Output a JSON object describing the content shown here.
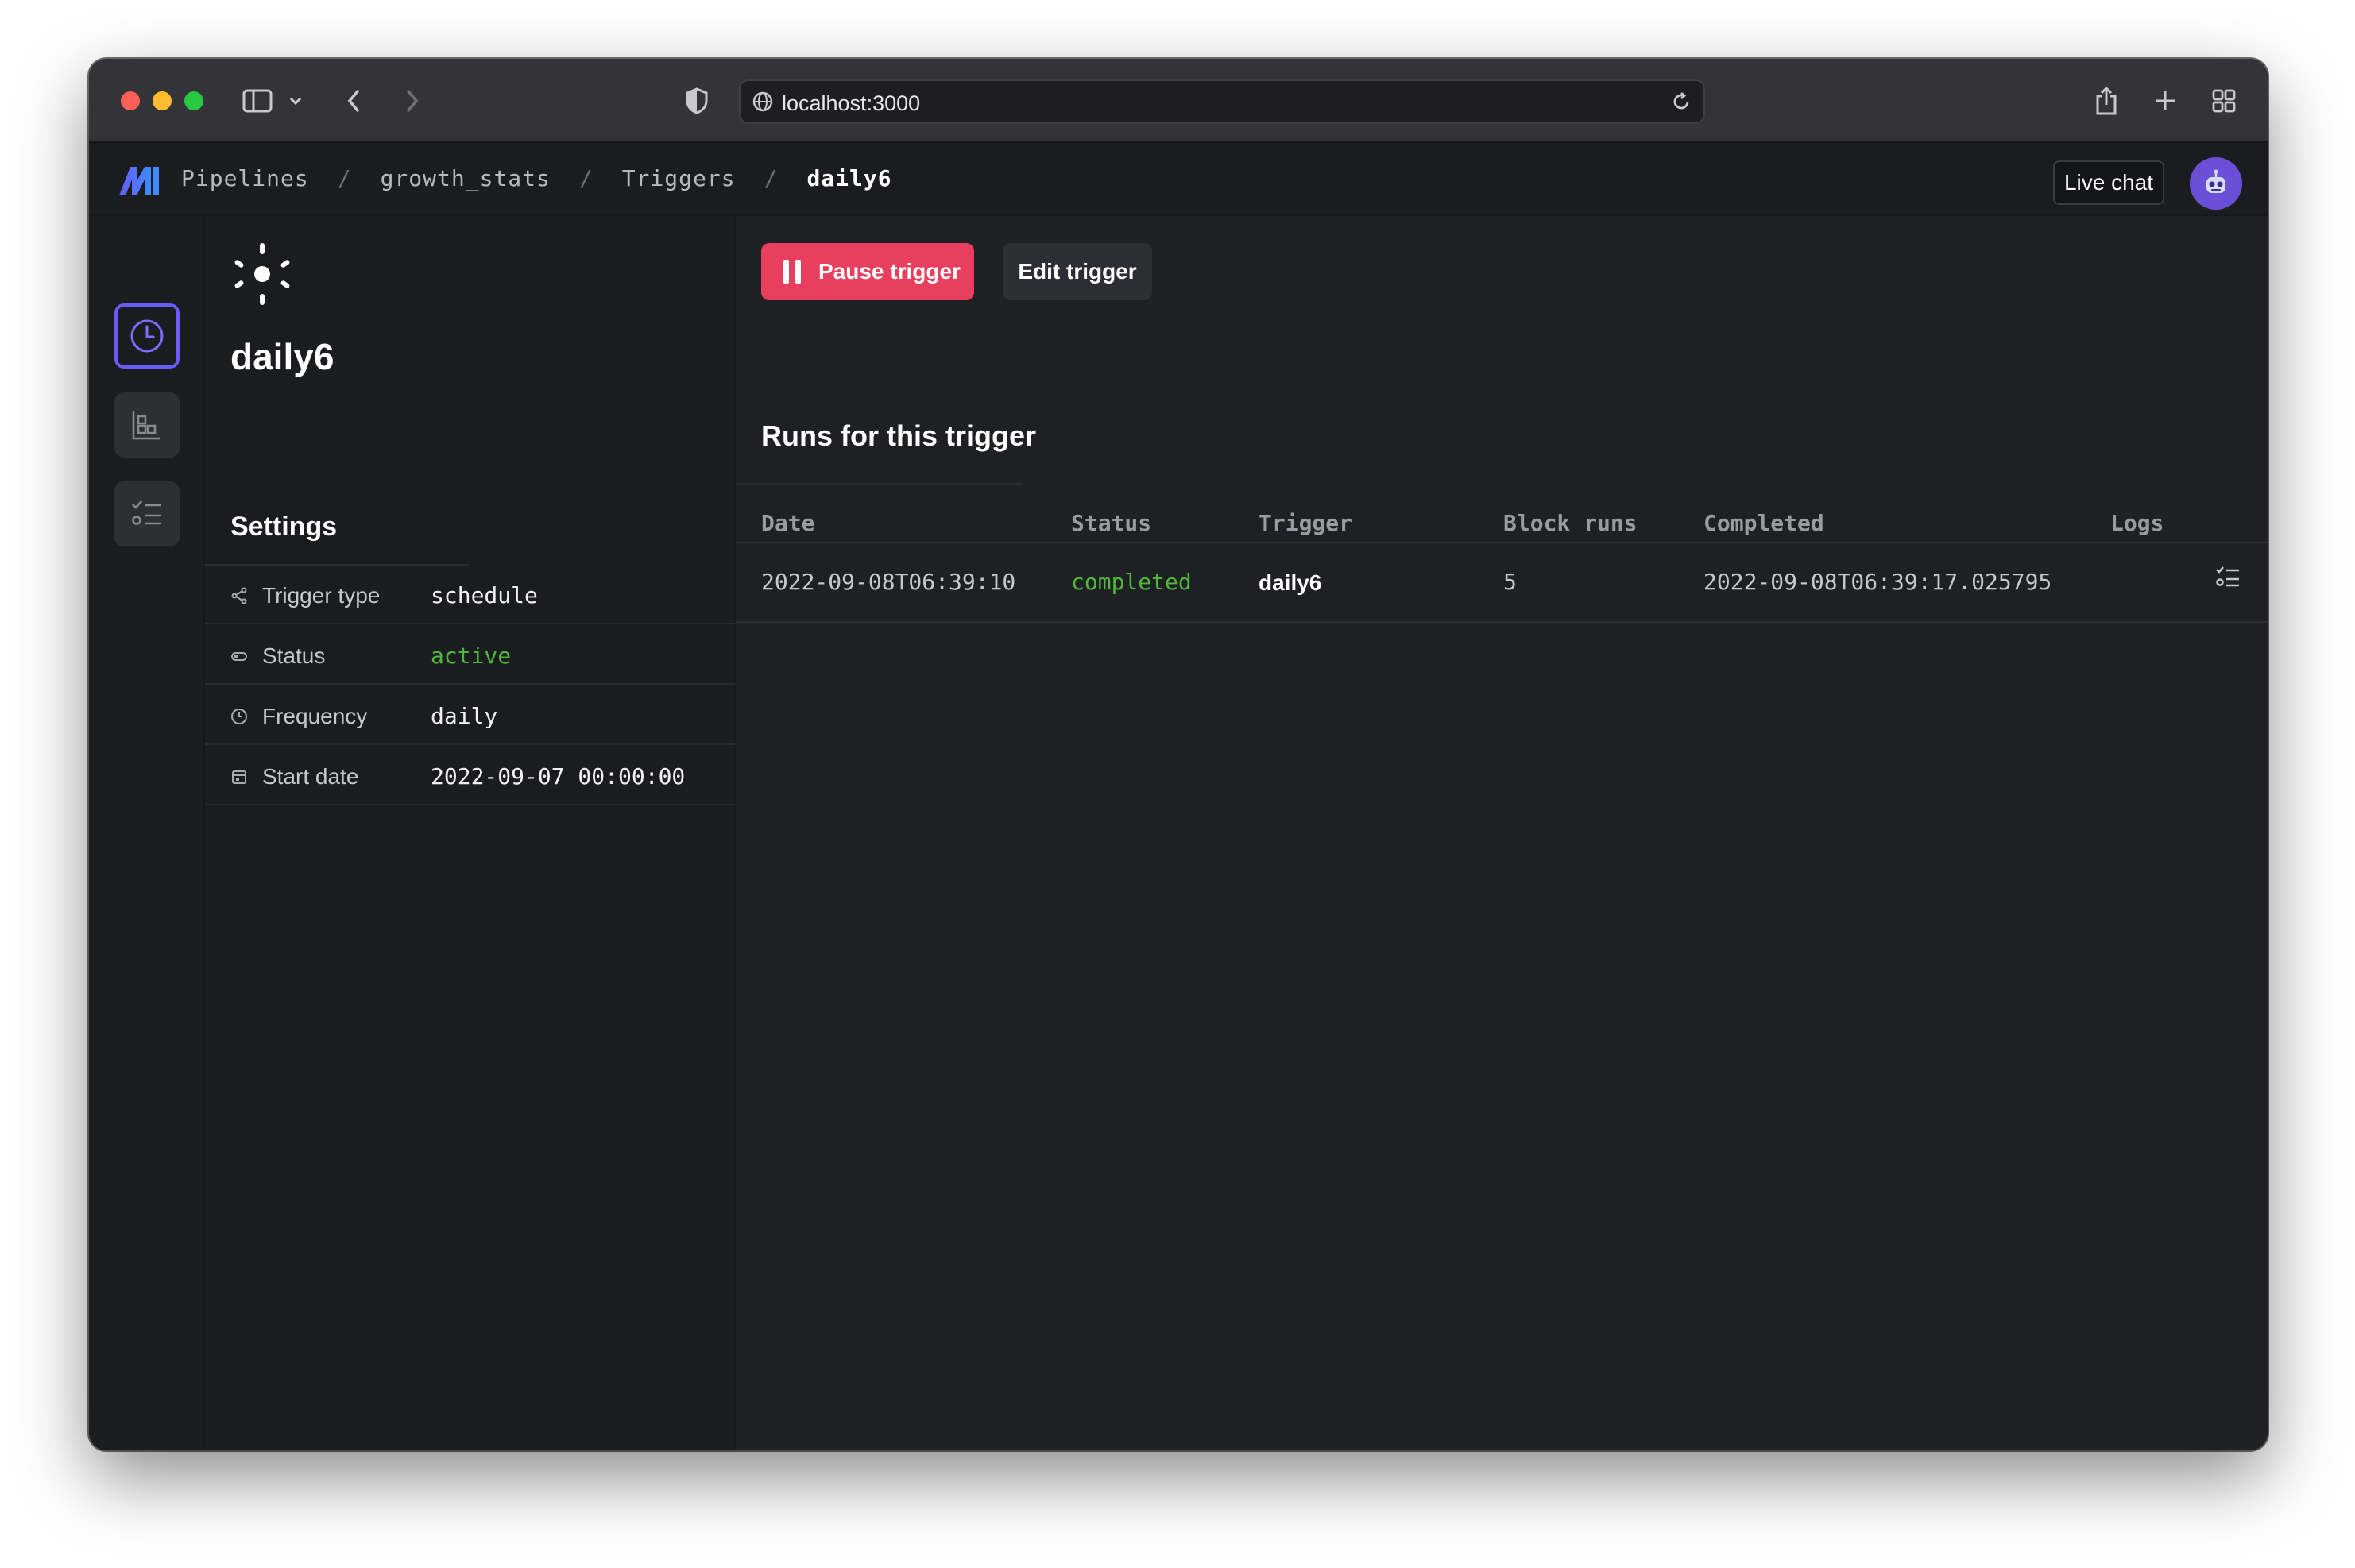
{
  "browser": {
    "url": "localhost:3000"
  },
  "header": {
    "breadcrumbs": [
      "Pipelines",
      "growth_stats",
      "Triggers",
      "daily6"
    ],
    "separator": "/",
    "live_chat_label": "Live chat"
  },
  "rail": {
    "items": [
      {
        "name": "triggers",
        "icon": "clock-icon",
        "active": true
      },
      {
        "name": "block-runs",
        "icon": "blocks-icon",
        "active": false
      },
      {
        "name": "logs",
        "icon": "checklist-icon",
        "active": false
      }
    ]
  },
  "trigger": {
    "icon": "sun-icon",
    "name": "daily6"
  },
  "settings": {
    "title": "Settings",
    "rows": [
      {
        "label": "Trigger type",
        "value": "schedule",
        "icon": "share-icon"
      },
      {
        "label": "Status",
        "value": "active",
        "icon": "toggle-icon"
      },
      {
        "label": "Frequency",
        "value": "daily",
        "icon": "clock-icon"
      },
      {
        "label": "Start date",
        "value": "2022-09-07 00:00:00",
        "icon": "calendar-icon"
      }
    ]
  },
  "actions": {
    "pause_label": "Pause trigger",
    "edit_label": "Edit trigger"
  },
  "runs": {
    "title": "Runs for this trigger",
    "columns": [
      "Date",
      "Status",
      "Trigger",
      "Block runs",
      "Completed",
      "Logs"
    ],
    "rows": [
      {
        "date": "2022-09-08T06:39:10",
        "status": "completed",
        "trigger": "daily6",
        "block_runs": "5",
        "completed": "2022-09-08T06:39:17.025795"
      }
    ]
  },
  "colors": {
    "accent": "#6a5af9",
    "danger": "#e83f5f",
    "success": "#4fb83b"
  }
}
